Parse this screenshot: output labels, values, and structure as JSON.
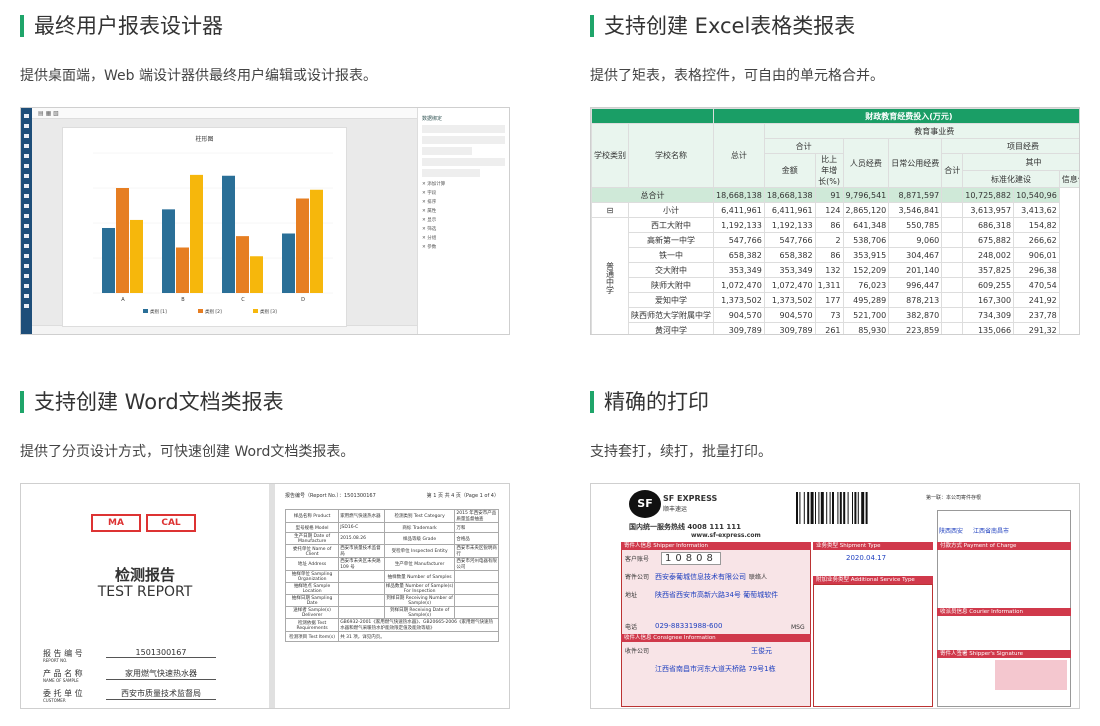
{
  "cards": [
    {
      "title": "最终用户报表设计器",
      "desc": "提供桌面端，Web 端设计器供最终用户编辑或设计报表。"
    },
    {
      "title": "支持创建 Excel表格类报表",
      "desc": "提供了矩表，表格控件，可自由的单元格合并。"
    },
    {
      "title": "支持创建 Word文档类报表",
      "desc": "提供了分页设计方式，可快速创建 Word文档类报表。"
    },
    {
      "title": "精确的打印",
      "desc": "支持套打，续打，批量打印。"
    }
  ],
  "designer": {
    "chart_title": "柱形图",
    "categories": [
      "A",
      "B",
      "C",
      "D"
    ],
    "series": [
      {
        "name": "类别 [1]",
        "color": "#2a6f97",
        "values": [
          7.43,
          9.56,
          13.4,
          6.8
        ]
      },
      {
        "name": "类别 [2]",
        "color": "#e67e22",
        "values": [
          12,
          5.2,
          6.5,
          10.8
        ]
      },
      {
        "name": "类别 [3]",
        "color": "#f6b70c",
        "values": [
          8.35,
          13.5,
          4.2,
          11.8
        ]
      }
    ],
    "ymax": 16,
    "side_title": "数据绑定",
    "side_items": [
      "添加计算",
      "字段",
      "排序",
      "属性",
      "显示",
      "筛选",
      "分组",
      "参数"
    ]
  },
  "excel": {
    "title": "财政教育经费投入(万元)",
    "h_type": "学校类别",
    "h_name": "学校名称",
    "h_total": "总计",
    "h_edu": "教育事业费",
    "h_sum": "合计",
    "h_amount": "金额",
    "h_ratio": "比上年增长(%)",
    "h_staff": "人员经费",
    "h_daily": "日常公用经费",
    "h_proj": "项目经费",
    "h_proj_sum": "合计",
    "h_among": "其中",
    "h_std": "标准化建设",
    "h_info": "信息化建设",
    "grand_label": "总合计",
    "grand": [
      "18,668,138",
      "18,668,138",
      "91",
      "9,796,541",
      "8,871,597",
      "",
      "10,725,882",
      "10,540,96"
    ],
    "group_toggle": "⊟",
    "group_label": "普通中学",
    "subtotal_label": "小计",
    "subtotal": [
      "6,411,961",
      "6,411,961",
      "124",
      "2,865,120",
      "3,546,841",
      "",
      "3,613,957",
      "3,413,62"
    ],
    "rows": [
      {
        "name": "西工大附中",
        "v": [
          "1,192,133",
          "1,192,133",
          "86",
          "641,348",
          "550,785",
          "",
          "686,318",
          "154,82"
        ]
      },
      {
        "name": "高新第一中学",
        "v": [
          "547,766",
          "547,766",
          "2",
          "538,706",
          "9,060",
          "",
          "675,882",
          "266,62"
        ]
      },
      {
        "name": "铁一中",
        "v": [
          "658,382",
          "658,382",
          "86",
          "353,915",
          "304,467",
          "",
          "248,002",
          "906,01"
        ]
      },
      {
        "name": "交大附中",
        "v": [
          "353,349",
          "353,349",
          "132",
          "152,209",
          "201,140",
          "",
          "357,825",
          "296,38"
        ]
      },
      {
        "name": "陕师大附中",
        "v": [
          "1,072,470",
          "1,072,470",
          "1,311",
          "76,023",
          "996,447",
          "",
          "609,255",
          "470,54"
        ]
      },
      {
        "name": "爱知中学",
        "v": [
          "1,373,502",
          "1,373,502",
          "177",
          "495,289",
          "878,213",
          "",
          "167,300",
          "241,92"
        ]
      },
      {
        "name": "陕西师范大学附属中学",
        "v": [
          "904,570",
          "904,570",
          "73",
          "521,700",
          "382,870",
          "",
          "734,309",
          "237,78"
        ]
      },
      {
        "name": "黄河中学",
        "v": [
          "309,789",
          "309,789",
          "261",
          "85,930",
          "223,859",
          "",
          "135,066",
          "291,32"
        ]
      }
    ]
  },
  "word": {
    "stamp1": "MA",
    "stamp2": "CAL",
    "report_cn": "检测报告",
    "report_en": "TEST REPORT",
    "f1_label": "报 告 编 号",
    "f1_en": "REPORT NO.",
    "f1_val": "1501300167",
    "f2_label": "产 品 名 称",
    "f2_en": "NAME OF SAMPLE",
    "f2_val": "家用燃气快速热水器",
    "f3_label": "委 托 单 位",
    "f3_en": "CUSTOMER",
    "f3_val": "西安市质量技术监督局",
    "p2_no": "报告编号（Report No.）：1501300167",
    "p2_page": "第 1 页 共 4 页（Page 1 of 4）",
    "p2_rows": [
      [
        "样品名称 Product",
        "家用燃气快速热水器",
        "检测类别 Test Category",
        "2015 年西安市产品质量监督抽查"
      ],
      [
        "型号规格 Model",
        "JSD16-C",
        "商标 Trademark",
        "万和"
      ],
      [
        "生产日期 Date of Manufacture",
        "2015.08.26",
        "样品等级 Grade",
        "合格品"
      ],
      [
        "委托单位 Name of Client",
        "西安市质量技术监督局",
        "受检单位 Inspected Entity",
        "西安市未央区锐明商行"
      ],
      [
        "地址 Address",
        "西安市未央区未央路 109 号",
        "生产单位 Manufacturer",
        "西安市河州电器有限公司"
      ],
      [
        "抽样单位 Sampling Organization",
        "",
        "抽样数量 Number of Samples",
        ""
      ],
      [
        "抽样地点 Sample Location",
        "",
        "样品数量 Number of Sample(s) For Inspection",
        ""
      ],
      [
        "抽样日期 Sampling Date",
        "",
        "到样日期 Receiving Number of Sample(s)",
        ""
      ],
      [
        "送样者 Sample(s) Deliverer",
        "",
        "到样日期 Receiving Date of Sample(s)",
        ""
      ],
      [
        "检测依据 Test Requirements",
        "GB6932-2001《家用燃气快速热水器》、GB20665-2006《家用燃气快速热水器和燃气采暖热水炉能效限定值及能效等级》",
        ""
      ],
      [
        "检测项目 Test Item(s)",
        "共 31 项，详见内页。",
        ""
      ]
    ]
  },
  "print": {
    "brand": "SF EXPRESS",
    "brand_cn": "顺丰速运",
    "hotline": "国内统一服务热线 4008 111 111",
    "web": "www.sf-express.com",
    "copy": "第一联：本公司寄件存根",
    "sender_hdr": "寄件人信息 Shipper Information",
    "acct_label": "客户账号",
    "acct": "10808",
    "company_label": "寄件公司",
    "company": "西安泰葡城信息技术有限公司",
    "contact_label": "联络人",
    "addr_label": "地址",
    "addr": "陕西省西安市高新六路34号 葡萄城软件",
    "tel_label": "电话",
    "tel": "029-88331988-600",
    "msg": "MSG",
    "recv_hdr": "收件人信息 Consignee Information",
    "recv_company_label": "收件公司",
    "recv_contact": "王俊元",
    "recv_addr": "江西省南昌市河东大道天桥路 79号1栋",
    "svc_hdr": "业务类型 Shipment Type",
    "date": "2020.04.17",
    "add_hdr": "附加业务类型 Additional Service Type",
    "area_code": "陕西西安",
    "area_dest": "江西省南昌市",
    "pay_hdr": "付款方式 Payment of Charge",
    "courier_hdr": "收派员信息 Courier Information",
    "sign_hdr": "寄件人签署 Shipper's Signature"
  }
}
